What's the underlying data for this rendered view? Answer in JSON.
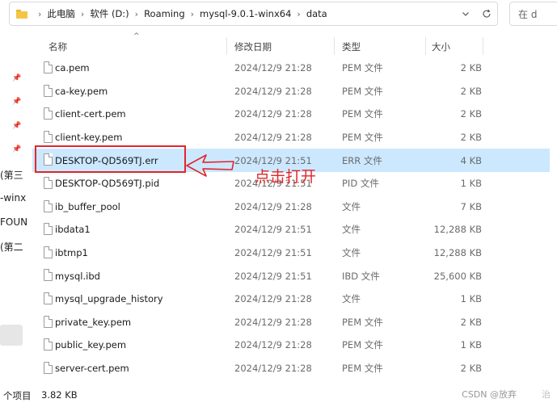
{
  "address": {
    "breadcrumbs": [
      "此电脑",
      "软件 (D:)",
      "Roaming",
      "mysql-9.0.1-winx64",
      "data"
    ],
    "dropdown_icon": "chevron-down-icon",
    "refresh_icon": "refresh-icon"
  },
  "search": {
    "placeholder": "在 d"
  },
  "nav_fragments": [
    "(第三",
    "-winx",
    "FOUN",
    "(第二"
  ],
  "columns": {
    "name": "名称",
    "date": "修改日期",
    "type": "类型",
    "size": "大小"
  },
  "files": [
    {
      "name": "ca.pem",
      "date": "2024/12/9 21:28",
      "type": "PEM 文件",
      "size": "2 KB"
    },
    {
      "name": "ca-key.pem",
      "date": "2024/12/9 21:28",
      "type": "PEM 文件",
      "size": "2 KB"
    },
    {
      "name": "client-cert.pem",
      "date": "2024/12/9 21:28",
      "type": "PEM 文件",
      "size": "2 KB"
    },
    {
      "name": "client-key.pem",
      "date": "2024/12/9 21:28",
      "type": "PEM 文件",
      "size": "2 KB"
    },
    {
      "name": "DESKTOP-QD569TJ.err",
      "date": "2024/12/9 21:51",
      "type": "ERR 文件",
      "size": "4 KB",
      "selected": true
    },
    {
      "name": "DESKTOP-QD569TJ.pid",
      "date": "2024/12/9 21:51",
      "type": "PID 文件",
      "size": "1 KB"
    },
    {
      "name": "ib_buffer_pool",
      "date": "2024/12/9 21:28",
      "type": "文件",
      "size": "7 KB"
    },
    {
      "name": "ibdata1",
      "date": "2024/12/9 21:51",
      "type": "文件",
      "size": "12,288 KB"
    },
    {
      "name": "ibtmp1",
      "date": "2024/12/9 21:51",
      "type": "文件",
      "size": "12,288 KB"
    },
    {
      "name": "mysql.ibd",
      "date": "2024/12/9 21:51",
      "type": "IBD 文件",
      "size": "25,600 KB"
    },
    {
      "name": "mysql_upgrade_history",
      "date": "2024/12/9 21:28",
      "type": "文件",
      "size": "1 KB"
    },
    {
      "name": "private_key.pem",
      "date": "2024/12/9 21:28",
      "type": "PEM 文件",
      "size": "2 KB"
    },
    {
      "name": "public_key.pem",
      "date": "2024/12/9 21:28",
      "type": "PEM 文件",
      "size": "1 KB"
    },
    {
      "name": "server-cert.pem",
      "date": "2024/12/9 21:28",
      "type": "PEM 文件",
      "size": "2 KB"
    }
  ],
  "annotation": {
    "text": "点击打开",
    "color": "#e0262b"
  },
  "status": {
    "items": "个项目",
    "size": "3.82 KB"
  },
  "watermark": {
    "text": "CSDN @放弃",
    "text2": "治"
  },
  "colors": {
    "selected_row": "#cce8ff",
    "folder": "#f3c544",
    "annotation": "#e0262b"
  }
}
